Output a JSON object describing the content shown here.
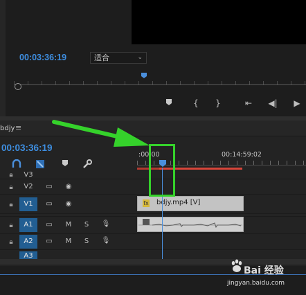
{
  "monitor": {
    "timecode": "00:03:36:19",
    "fit_label": "适合",
    "controls": [
      {
        "name": "add-marker-icon",
        "glyph": "⬟"
      },
      {
        "name": "mark-in-icon",
        "glyph": "{"
      },
      {
        "name": "mark-out-icon",
        "glyph": "}"
      },
      {
        "name": "go-to-in-icon",
        "glyph": "⇤"
      },
      {
        "name": "step-back-icon",
        "glyph": "◀|"
      },
      {
        "name": "play-icon",
        "glyph": "▶"
      }
    ]
  },
  "timeline": {
    "sequence_name": "bdjy",
    "menu_glyph": "≡",
    "timecode": "00:03:36:19",
    "ruler_labels": [
      ":00:00",
      "00:14:59:02"
    ],
    "tracks": [
      {
        "name": "V3",
        "targeted": false,
        "kind": "video"
      },
      {
        "name": "V2",
        "targeted": false,
        "kind": "video"
      },
      {
        "name": "V1",
        "targeted": true,
        "kind": "video"
      },
      {
        "name": "A1",
        "targeted": true,
        "kind": "audio"
      },
      {
        "name": "A2",
        "targeted": true,
        "kind": "audio"
      },
      {
        "name": "A3",
        "targeted": true,
        "kind": "audio"
      }
    ],
    "video_clip_label": "bdjy.mp4 [V]",
    "fx_label": "fx",
    "mute_label": "M",
    "solo_label": "S"
  },
  "watermark": {
    "brand": "Bai  经验",
    "site": "jingyan.baidu.com"
  },
  "colors": {
    "timecode": "#3e8ee0",
    "track_targeted": "#225e92",
    "annotation": "#35d22b",
    "work_area": "#d9463a"
  }
}
